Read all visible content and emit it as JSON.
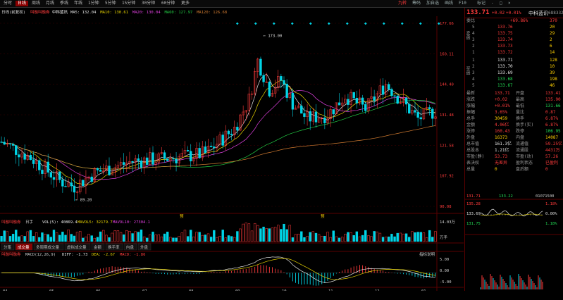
{
  "colors": {
    "up": "#ff3b3b",
    "down": "#00d4e6",
    "ma5": "#e6e6e6",
    "ma10": "#e6d200",
    "ma20": "#e040e0",
    "ma60": "#22cc44",
    "ma120": "#d07a30",
    "bg": "#000000"
  },
  "topbar": {
    "tabs": [
      "分时",
      "日线",
      "周线",
      "月线",
      "季线",
      "年线",
      "1分钟",
      "5分钟",
      "15分钟",
      "30分钟",
      "60分钟",
      "更多"
    ],
    "active": "日线",
    "right_icons": [
      "九转",
      "筹码",
      "加自选",
      "画线",
      "F10",
      "标记",
      "-",
      "□",
      "×"
    ]
  },
  "main": {
    "info": {
      "period": "日线(前复权)",
      "tag": "叫融叫融券",
      "name": "中科蓝讯",
      "ma5": "MA5: 132.04",
      "ma10": "MA10: 130.61",
      "ma20": "MA20: 130.04",
      "ma60": "MA60: 127.97",
      "ma120": "MA120: 126.68"
    },
    "price_axis": [
      "177.66",
      "160.11",
      "144.40",
      "131.48",
      "121.58",
      "107.92",
      "90.08"
    ],
    "high_mark": "173.00",
    "low_mark": "89.20",
    "marks": [
      {
        "label": "预"
      },
      {
        "label": "预"
      }
    ],
    "volume": {
      "tag": "叫融叫融券",
      "label": "日手",
      "vol": "VOL(5): 40869.4",
      "mavol5": "MAVOL5: 32179.7",
      "mavol10": "MAVOL10: 27304.1",
      "axis": [
        "14.03万",
        "万手"
      ]
    },
    "tabs": [
      "分笔",
      "成交量",
      "多周期成交量",
      "虚拟成交量",
      "金额",
      "换手率",
      "内盘",
      "外盘"
    ],
    "macd": {
      "tag": "叫融叫融券",
      "label": "MACD(12,26,9)",
      "diff": "DIFF: -1.73",
      "dea": "DEA: -2.67",
      "macd": "MACD: -1.86",
      "axis_right": "指标说明",
      "axis": [
        "5.00",
        "0.00",
        "-5.00"
      ]
    },
    "dates": [
      "04",
      "05",
      "06",
      "07",
      "08",
      "09",
      "10",
      "11",
      "12",
      "01"
    ]
  },
  "quote": {
    "price": "133.71",
    "change": "+0.02",
    "pct": "+0.01%",
    "name": "中科蓝讯",
    "code": "688332",
    "weibi_label": "委比",
    "weibi_value": "+69.86%",
    "weibi_diff": "370",
    "sell": [
      {
        "label": "5",
        "price": "133.76",
        "vol": "20"
      },
      {
        "label": "4",
        "price": "133.75",
        "vol": "29"
      },
      {
        "label": "3",
        "price": "133.74",
        "vol": "2"
      },
      {
        "label": "2",
        "price": "133.73",
        "vol": "6"
      },
      {
        "label": "1",
        "price": "133.72",
        "vol": "14"
      }
    ],
    "buy": [
      {
        "label": "1",
        "price": "133.71",
        "vol": "128"
      },
      {
        "label": "2",
        "price": "133.70",
        "vol": "10"
      },
      {
        "label": "3",
        "price": "133.69",
        "vol": "39"
      },
      {
        "label": "4",
        "price": "133.68",
        "vol": "198"
      },
      {
        "label": "5",
        "price": "133.67",
        "vol": "46"
      }
    ],
    "stats": [
      {
        "k1": "最新",
        "v1": "133.71",
        "k2": "开盘",
        "v2": "133.41"
      },
      {
        "k1": "涨跌",
        "v1": "+0.02",
        "k2": "最高",
        "v2": "135.90"
      },
      {
        "k1": "涨幅",
        "v1": "+0.01%",
        "k2": "最低",
        "v2": "131.66"
      },
      {
        "k1": "振幅",
        "v1": "3.65%",
        "k2": "量比",
        "v2": "0.87"
      },
      {
        "k1": "总手",
        "v1": "30459",
        "k2": "换手",
        "v2": "6.87%"
      },
      {
        "k1": "金额",
        "v1": "4.06亿",
        "k2": "换手(实)",
        "v2": "6.87%"
      },
      {
        "k1": "涨停",
        "v1": "160.43",
        "k2": "跌停",
        "v2": "106.95"
      },
      {
        "k1": "外盘",
        "v1": "16373",
        "k2": "内盘",
        "v2": "14087"
      },
      {
        "k1": "总市值",
        "v1": "161.3亿",
        "k2": "流通值",
        "v2": "59.25亿"
      },
      {
        "k1": "总股本",
        "v1": "1.21亿",
        "k2": "流通股",
        "v2": "4431万"
      },
      {
        "k1": "市盈(静)",
        "v1": "53.73",
        "k2": "市盈(动)",
        "v2": "57.26"
      },
      {
        "k1": "表决权",
        "v1": "无差异",
        "k2": "盈利状态",
        "v2": "已盈利"
      },
      {
        "k1": "总量",
        "v1": "0",
        "k2": "盘后额",
        "v2": "0"
      }
    ],
    "mini": {
      "left": "131.71",
      "right": "133.22",
      "time": "01071500",
      "axis_l": [
        "135.28",
        "133.69",
        "131.75"
      ],
      "axis_r": [
        "1.18%",
        "0.00%",
        "1.18%"
      ],
      "pct_label": "0.00%"
    }
  }
}
